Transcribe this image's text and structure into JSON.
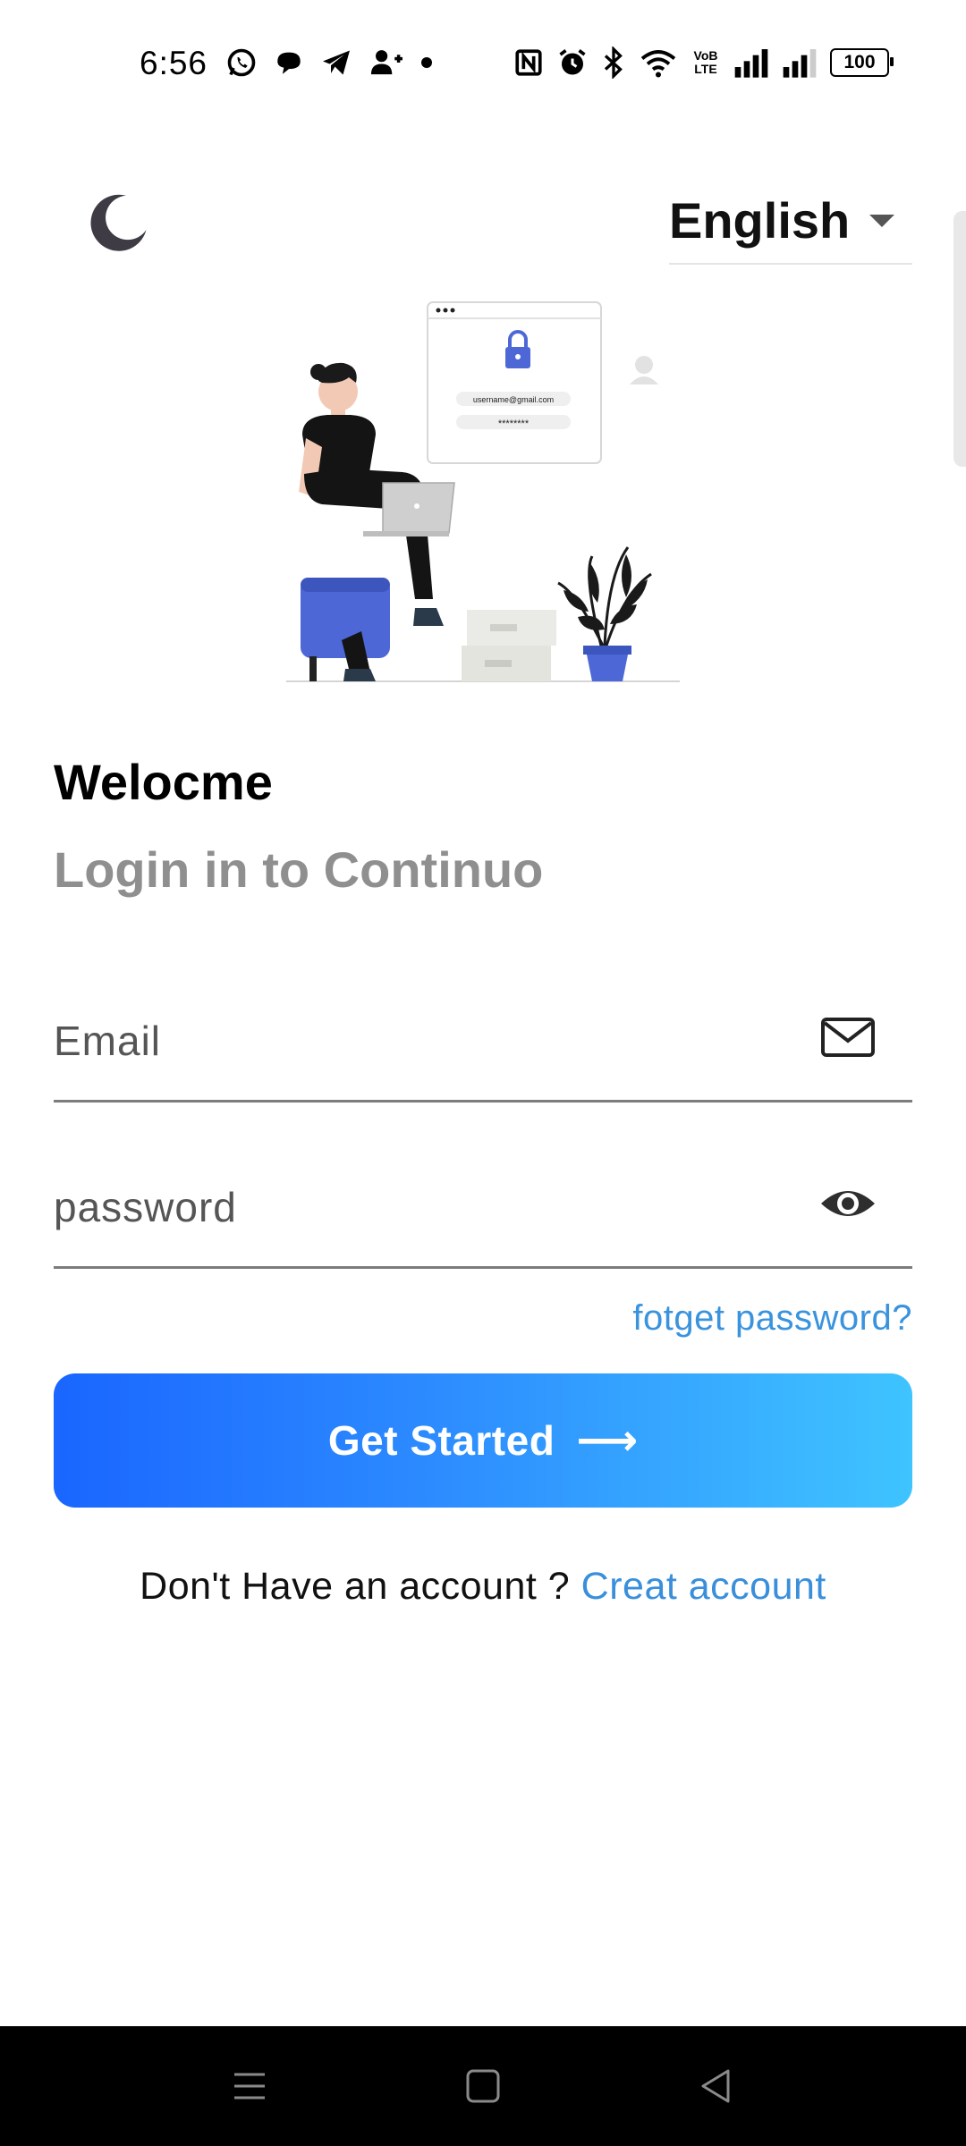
{
  "status_bar": {
    "time": "6:56",
    "notification_icons": [
      "whatsapp-icon",
      "chat-icon",
      "telegram-icon",
      "person-add-icon",
      "dot-icon"
    ],
    "system_icons": [
      "nfc-icon",
      "alarm-icon",
      "bluetooth-icon",
      "wifi-icon",
      "volte-icon",
      "signal-icon",
      "signal-icon"
    ],
    "volte_text": "VoB LTE",
    "battery": "100"
  },
  "header": {
    "theme_icon": "moon-icon",
    "language": "English"
  },
  "hero": {
    "illustration": "login-illustration",
    "card_email": "username@gmail.com",
    "card_password": "********"
  },
  "headings": {
    "welcome": "Welocme",
    "subtitle": "Login in to Continuo"
  },
  "form": {
    "email_placeholder": "Email",
    "password_placeholder": "password",
    "email_icon": "mail-icon",
    "password_icon": "eye-icon",
    "forgot_label": "fotget password?",
    "submit_label": "Get Started",
    "submit_arrow": "⟶"
  },
  "signup": {
    "prompt": "Don't Have an account ? ",
    "link": "Creat account"
  },
  "navigation": {
    "items": [
      "menu-icon",
      "home-icon",
      "back-icon"
    ]
  },
  "colors": {
    "accent_start": "#1a66ff",
    "accent_end": "#3fc4ff",
    "link": "#3a93dd",
    "subtitle": "#8f8f8f"
  }
}
